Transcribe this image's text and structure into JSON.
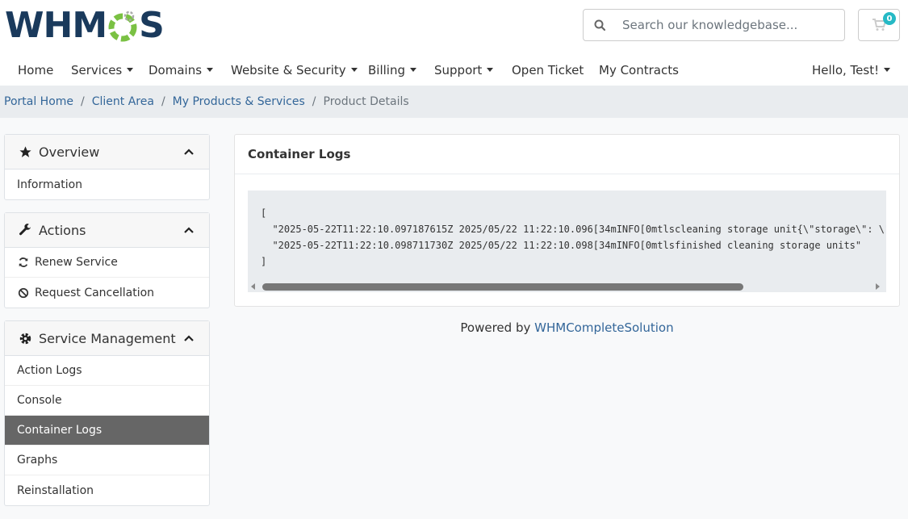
{
  "header": {
    "logo_text_left": "WHM",
    "logo_text_right": "S",
    "search": {
      "placeholder": "Search our knowledgebase..."
    },
    "cart": {
      "count": "0",
      "icon": "shopping-cart-icon"
    }
  },
  "nav": {
    "items": [
      {
        "label": "Home",
        "dropdown": false
      },
      {
        "label": "Services",
        "dropdown": true
      },
      {
        "label": "Domains",
        "dropdown": true
      },
      {
        "label": "Website & Security",
        "dropdown": true
      },
      {
        "label": "Billing",
        "dropdown": true
      },
      {
        "label": "Support",
        "dropdown": true
      },
      {
        "label": "Open Ticket",
        "dropdown": false
      },
      {
        "label": "My Contracts",
        "dropdown": false
      }
    ],
    "user": "Hello, Test!"
  },
  "breadcrumb": {
    "items": [
      "Portal Home",
      "Client Area",
      "My Products & Services"
    ],
    "separator": "/",
    "active": "Product Details"
  },
  "sidebar": {
    "overview": {
      "title": "Overview",
      "icon": "star-icon",
      "items": [
        "Information"
      ]
    },
    "actions": {
      "title": "Actions",
      "icon": "wrench-icon",
      "items": [
        {
          "label": "Renew Service",
          "icon": "refresh-icon"
        },
        {
          "label": "Request Cancellation",
          "icon": "ban-icon"
        }
      ]
    },
    "service_management": {
      "title": "Service Management",
      "icon": "gear-icon",
      "items": [
        "Action Logs",
        "Console",
        "Container Logs",
        "Graphs",
        "Reinstallation"
      ],
      "active": "Container Logs"
    }
  },
  "main": {
    "title": "Container Logs",
    "log_lines": [
      "[",
      "  \"2025-05-22T11:22:10.097187615Z 2025/05/22 11:22:10.096[34mINFO[0mtlscleaning storage unit{\\\"storage\\\": \\\"",
      "  \"2025-05-22T11:22:10.098711730Z 2025/05/22 11:22:10.098[34mINFO[0mtlsfinished cleaning storage units\"",
      "]"
    ]
  },
  "footer": {
    "prefix": "Powered by",
    "link": "WHMCompleteSolution"
  },
  "colors": {
    "brand_dark": "#1a3a5c",
    "brand_green": "#7ac143",
    "link": "#336699",
    "badge": "#26b9c5",
    "active_item": "#666666"
  }
}
